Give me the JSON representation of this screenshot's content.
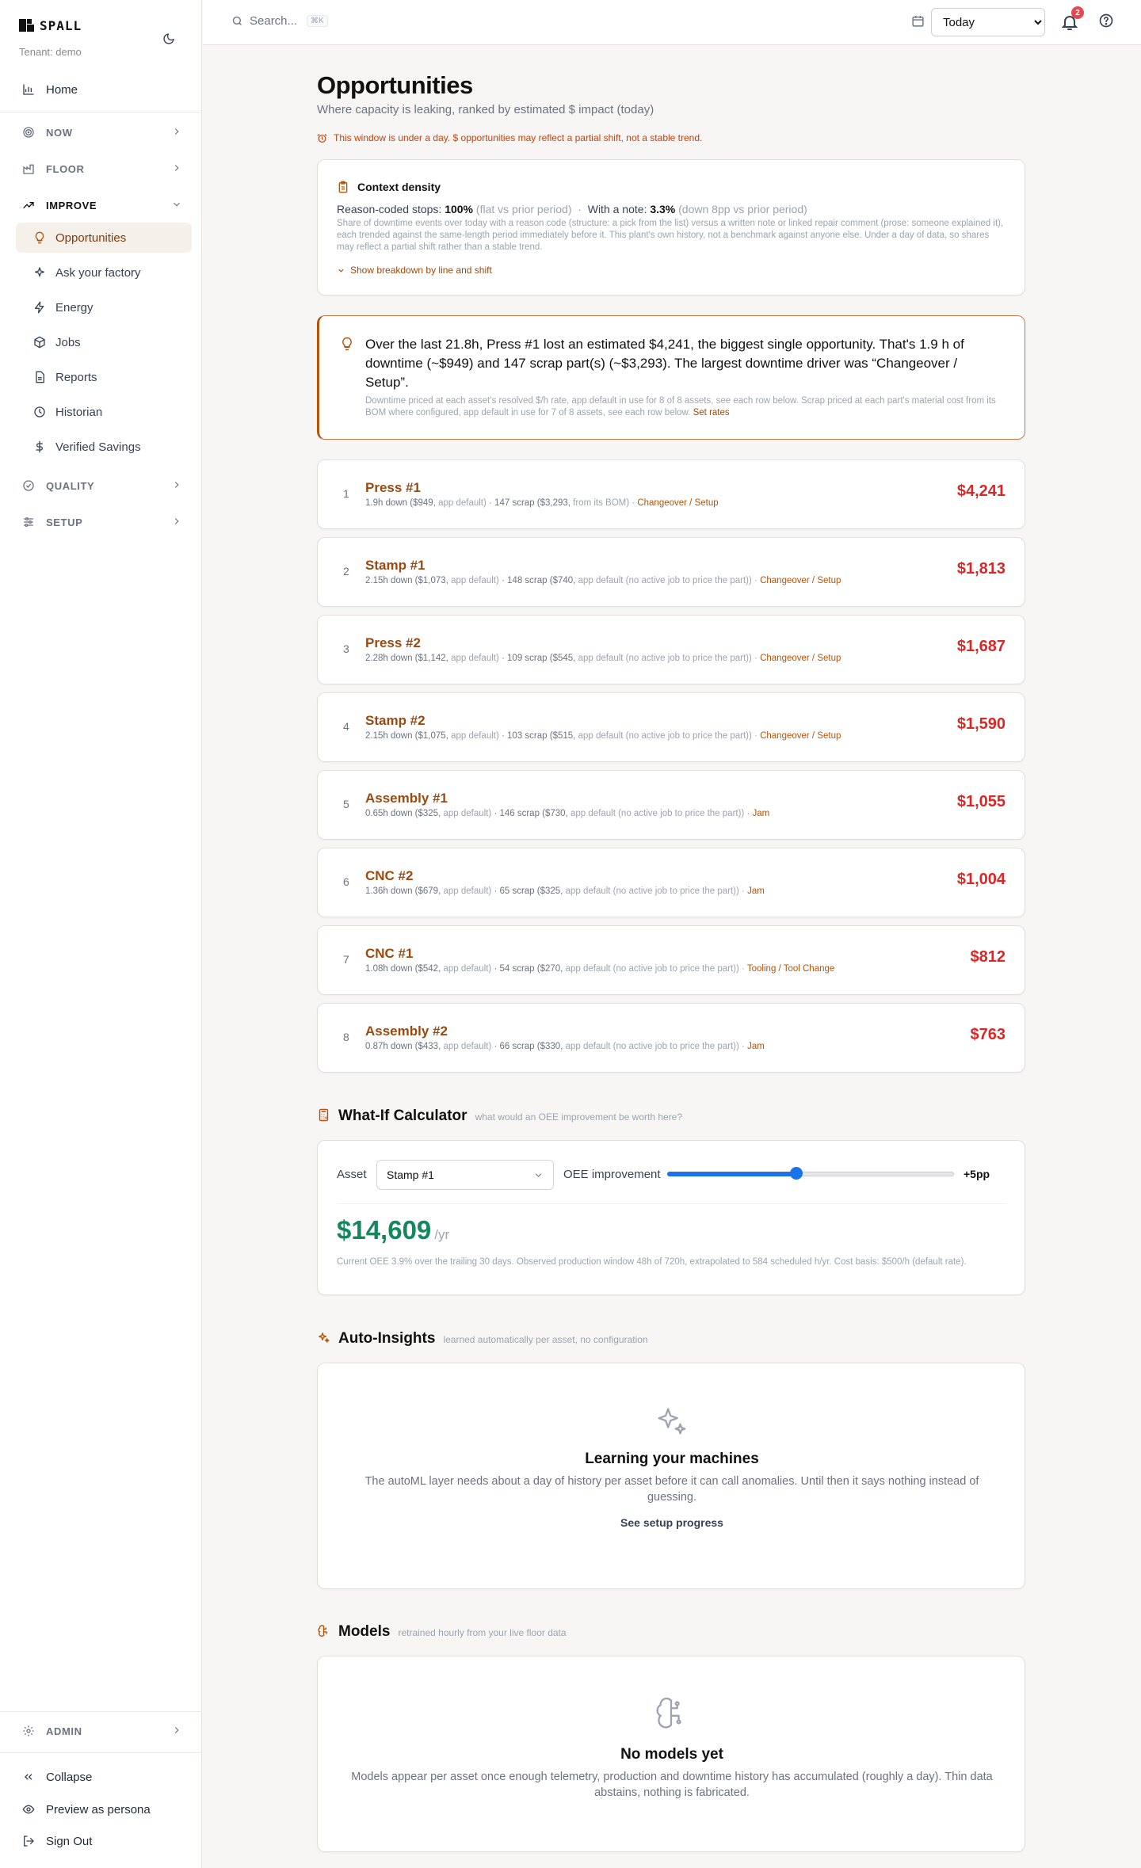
{
  "app": {
    "brand": "SPALL",
    "tenant": "Tenant: demo"
  },
  "sidebar": {
    "home": "Home",
    "sections": {
      "now": "NOW",
      "floor": "FLOOR",
      "improve": "IMPROVE",
      "quality": "QUALITY",
      "setup": "SETUP",
      "admin": "ADMIN"
    },
    "improve_items": [
      {
        "label": "Opportunities",
        "icon": "lightbulb-icon"
      },
      {
        "label": "Ask your factory",
        "icon": "sparkles-icon"
      },
      {
        "label": "Energy",
        "icon": "zap-icon"
      },
      {
        "label": "Jobs",
        "icon": "package-icon"
      },
      {
        "label": "Reports",
        "icon": "file-text-icon"
      },
      {
        "label": "Historian",
        "icon": "clock-icon"
      },
      {
        "label": "Verified Savings",
        "icon": "dollar-icon"
      }
    ],
    "footer": {
      "collapse": "Collapse",
      "preview": "Preview as persona",
      "signout": "Sign Out"
    }
  },
  "topbar": {
    "search_placeholder": "Search...",
    "search_shortcut": "⌘K",
    "range": "Today",
    "range_options": [
      "Today"
    ],
    "notifications_count": "2"
  },
  "page": {
    "title": "Opportunities",
    "subtitle": "Where capacity is leaking, ranked by estimated $ impact (today)",
    "warning": "This window is under a day. $ opportunities may reflect a partial shift, not a stable trend."
  },
  "context": {
    "title": "Context density",
    "reason_label": "Reason-coded stops:",
    "reason_value": "100%",
    "reason_delta": "(flat vs prior period)",
    "note_label": "With a note:",
    "note_value": "3.3%",
    "note_delta": "(down 8pp vs prior period)",
    "description": "Share of downtime events over today with a reason code (structure: a pick from the list) versus a written note or linked repair comment (prose: someone explained it), each trended against the same-length period immediately before it. This plant's own history, not a benchmark against anyone else. Under a day of data, so shares may reflect a partial shift rather than a stable trend.",
    "toggle": "Show breakdown by line and shift"
  },
  "hero": {
    "text": "Over the last 21.8h, Press #1 lost an estimated $4,241, the biggest single opportunity. That's 1.9 h of downtime (~$949) and 147 scrap part(s) (~$3,293). The largest downtime driver was “Changeover / Setup”.",
    "note": "Downtime priced at each asset's resolved $/h rate, app default in use for 8 of 8 assets, see each row below. Scrap priced at each part's material cost from its BOM where configured, app default in use for 7 of 8 assets, see each row below.",
    "link": "Set rates"
  },
  "opportunities": [
    {
      "rank": "1",
      "name": "Press #1",
      "down": "1.9h down ($949,",
      "down_src": "app default)",
      "scrap": "· 147 scrap ($3,293,",
      "scrap_src": "from its BOM)",
      "cause": "Changeover / Setup",
      "amount": "$4,241"
    },
    {
      "rank": "2",
      "name": "Stamp #1",
      "down": "2.15h down ($1,073,",
      "down_src": "app default)",
      "scrap": "· 148 scrap ($740,",
      "scrap_src": "app default (no active job to price the part))",
      "cause": "Changeover / Setup",
      "amount": "$1,813"
    },
    {
      "rank": "3",
      "name": "Press #2",
      "down": "2.28h down ($1,142,",
      "down_src": "app default)",
      "scrap": "· 109 scrap ($545,",
      "scrap_src": "app default (no active job to price the part))",
      "cause": "Changeover / Setup",
      "amount": "$1,687"
    },
    {
      "rank": "4",
      "name": "Stamp #2",
      "down": "2.15h down ($1,075,",
      "down_src": "app default)",
      "scrap": "· 103 scrap ($515,",
      "scrap_src": "app default (no active job to price the part))",
      "cause": "Changeover / Setup",
      "amount": "$1,590"
    },
    {
      "rank": "5",
      "name": "Assembly #1",
      "down": "0.65h down ($325,",
      "down_src": "app default)",
      "scrap": "· 146 scrap ($730,",
      "scrap_src": "app default (no active job to price the part))",
      "cause": "Jam",
      "amount": "$1,055"
    },
    {
      "rank": "6",
      "name": "CNC #2",
      "down": "1.36h down ($679,",
      "down_src": "app default)",
      "scrap": "· 65 scrap ($325,",
      "scrap_src": "app default (no active job to price the part))",
      "cause": "Jam",
      "amount": "$1,004"
    },
    {
      "rank": "7",
      "name": "CNC #1",
      "down": "1.08h down ($542,",
      "down_src": "app default)",
      "scrap": "· 54 scrap ($270,",
      "scrap_src": "app default (no active job to price the part))",
      "cause": "Tooling / Tool Change",
      "amount": "$812"
    },
    {
      "rank": "8",
      "name": "Assembly #2",
      "down": "0.87h down ($433,",
      "down_src": "app default)",
      "scrap": "· 66 scrap ($330,",
      "scrap_src": "app default (no active job to price the part))",
      "cause": "Jam",
      "amount": "$763"
    }
  ],
  "whatif": {
    "title": "What-If Calculator",
    "subtitle": "what would an OEE improvement be worth here?",
    "asset_label": "Asset",
    "asset_value": "Stamp #1",
    "oee_label": "OEE improvement",
    "slider_fraction": 0.45,
    "oee_value": "+5pp",
    "value": "$14,609",
    "unit": "/yr",
    "note": "Current OEE 3.9% over the trailing 30 days. Observed production window 48h of 720h, extrapolated to 584 scheduled h/yr. Cost basis: $500/h (default rate)."
  },
  "insights": {
    "title": "Auto-Insights",
    "subtitle": "learned automatically per asset, no configuration",
    "empty_title": "Learning your machines",
    "empty_desc": "The autoML layer needs about a day of history per asset before it can call anomalies. Until then it says nothing instead of guessing.",
    "link": "See setup progress"
  },
  "models": {
    "title": "Models",
    "subtitle": "retrained hourly from your live floor data",
    "empty_title": "No models yet",
    "empty_desc": "Models appear per asset once enough telemetry, production and downtime history has accumulated (roughly a day). Thin data abstains, nothing is fabricated."
  }
}
